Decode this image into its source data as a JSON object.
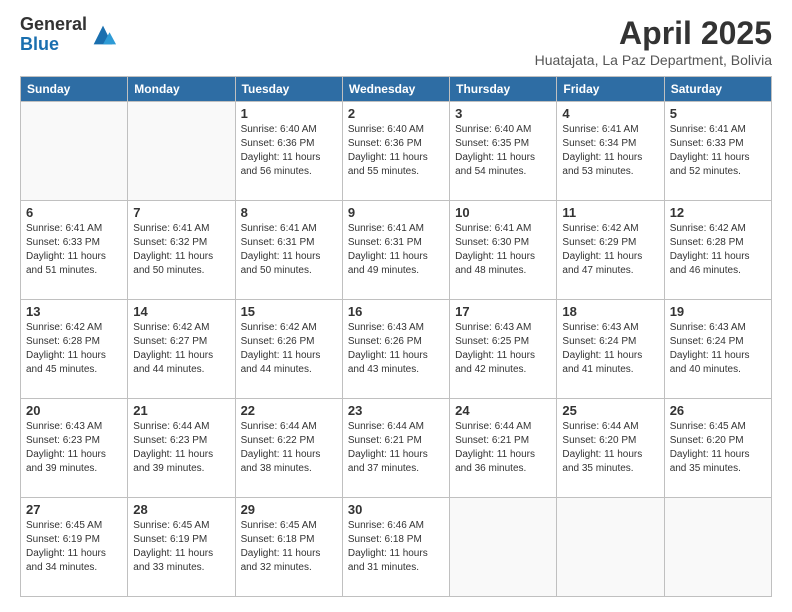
{
  "header": {
    "logo": {
      "general": "General",
      "blue": "Blue"
    },
    "title": "April 2025",
    "location": "Huatajata, La Paz Department, Bolivia"
  },
  "weekdays": [
    "Sunday",
    "Monday",
    "Tuesday",
    "Wednesday",
    "Thursday",
    "Friday",
    "Saturday"
  ],
  "weeks": [
    [
      {
        "day": "",
        "info": ""
      },
      {
        "day": "",
        "info": ""
      },
      {
        "day": "1",
        "info": "Sunrise: 6:40 AM\nSunset: 6:36 PM\nDaylight: 11 hours and 56 minutes."
      },
      {
        "day": "2",
        "info": "Sunrise: 6:40 AM\nSunset: 6:36 PM\nDaylight: 11 hours and 55 minutes."
      },
      {
        "day": "3",
        "info": "Sunrise: 6:40 AM\nSunset: 6:35 PM\nDaylight: 11 hours and 54 minutes."
      },
      {
        "day": "4",
        "info": "Sunrise: 6:41 AM\nSunset: 6:34 PM\nDaylight: 11 hours and 53 minutes."
      },
      {
        "day": "5",
        "info": "Sunrise: 6:41 AM\nSunset: 6:33 PM\nDaylight: 11 hours and 52 minutes."
      }
    ],
    [
      {
        "day": "6",
        "info": "Sunrise: 6:41 AM\nSunset: 6:33 PM\nDaylight: 11 hours and 51 minutes."
      },
      {
        "day": "7",
        "info": "Sunrise: 6:41 AM\nSunset: 6:32 PM\nDaylight: 11 hours and 50 minutes."
      },
      {
        "day": "8",
        "info": "Sunrise: 6:41 AM\nSunset: 6:31 PM\nDaylight: 11 hours and 50 minutes."
      },
      {
        "day": "9",
        "info": "Sunrise: 6:41 AM\nSunset: 6:31 PM\nDaylight: 11 hours and 49 minutes."
      },
      {
        "day": "10",
        "info": "Sunrise: 6:41 AM\nSunset: 6:30 PM\nDaylight: 11 hours and 48 minutes."
      },
      {
        "day": "11",
        "info": "Sunrise: 6:42 AM\nSunset: 6:29 PM\nDaylight: 11 hours and 47 minutes."
      },
      {
        "day": "12",
        "info": "Sunrise: 6:42 AM\nSunset: 6:28 PM\nDaylight: 11 hours and 46 minutes."
      }
    ],
    [
      {
        "day": "13",
        "info": "Sunrise: 6:42 AM\nSunset: 6:28 PM\nDaylight: 11 hours and 45 minutes."
      },
      {
        "day": "14",
        "info": "Sunrise: 6:42 AM\nSunset: 6:27 PM\nDaylight: 11 hours and 44 minutes."
      },
      {
        "day": "15",
        "info": "Sunrise: 6:42 AM\nSunset: 6:26 PM\nDaylight: 11 hours and 44 minutes."
      },
      {
        "day": "16",
        "info": "Sunrise: 6:43 AM\nSunset: 6:26 PM\nDaylight: 11 hours and 43 minutes."
      },
      {
        "day": "17",
        "info": "Sunrise: 6:43 AM\nSunset: 6:25 PM\nDaylight: 11 hours and 42 minutes."
      },
      {
        "day": "18",
        "info": "Sunrise: 6:43 AM\nSunset: 6:24 PM\nDaylight: 11 hours and 41 minutes."
      },
      {
        "day": "19",
        "info": "Sunrise: 6:43 AM\nSunset: 6:24 PM\nDaylight: 11 hours and 40 minutes."
      }
    ],
    [
      {
        "day": "20",
        "info": "Sunrise: 6:43 AM\nSunset: 6:23 PM\nDaylight: 11 hours and 39 minutes."
      },
      {
        "day": "21",
        "info": "Sunrise: 6:44 AM\nSunset: 6:23 PM\nDaylight: 11 hours and 39 minutes."
      },
      {
        "day": "22",
        "info": "Sunrise: 6:44 AM\nSunset: 6:22 PM\nDaylight: 11 hours and 38 minutes."
      },
      {
        "day": "23",
        "info": "Sunrise: 6:44 AM\nSunset: 6:21 PM\nDaylight: 11 hours and 37 minutes."
      },
      {
        "day": "24",
        "info": "Sunrise: 6:44 AM\nSunset: 6:21 PM\nDaylight: 11 hours and 36 minutes."
      },
      {
        "day": "25",
        "info": "Sunrise: 6:44 AM\nSunset: 6:20 PM\nDaylight: 11 hours and 35 minutes."
      },
      {
        "day": "26",
        "info": "Sunrise: 6:45 AM\nSunset: 6:20 PM\nDaylight: 11 hours and 35 minutes."
      }
    ],
    [
      {
        "day": "27",
        "info": "Sunrise: 6:45 AM\nSunset: 6:19 PM\nDaylight: 11 hours and 34 minutes."
      },
      {
        "day": "28",
        "info": "Sunrise: 6:45 AM\nSunset: 6:19 PM\nDaylight: 11 hours and 33 minutes."
      },
      {
        "day": "29",
        "info": "Sunrise: 6:45 AM\nSunset: 6:18 PM\nDaylight: 11 hours and 32 minutes."
      },
      {
        "day": "30",
        "info": "Sunrise: 6:46 AM\nSunset: 6:18 PM\nDaylight: 11 hours and 31 minutes."
      },
      {
        "day": "",
        "info": ""
      },
      {
        "day": "",
        "info": ""
      },
      {
        "day": "",
        "info": ""
      }
    ]
  ]
}
